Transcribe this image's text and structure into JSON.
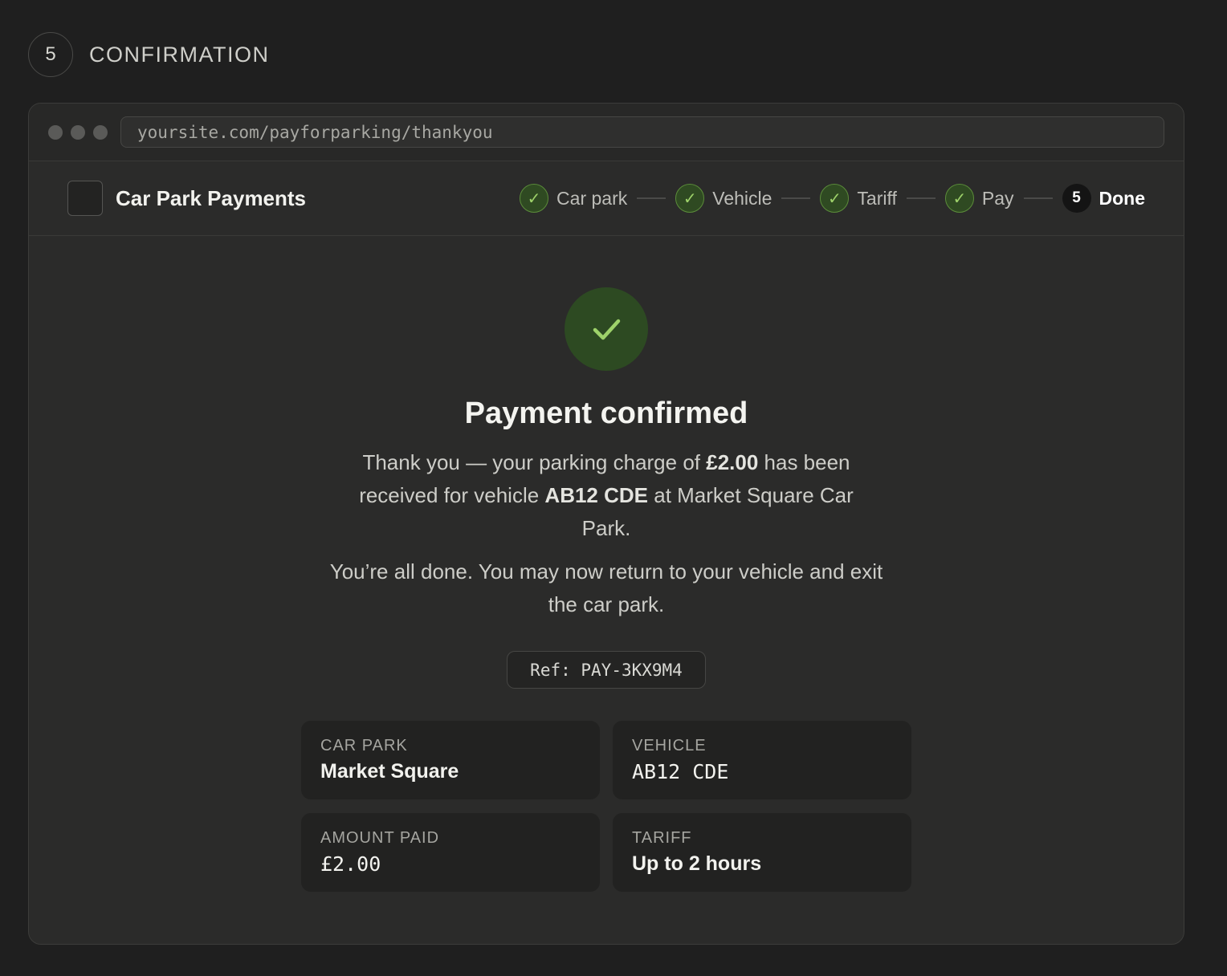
{
  "step": {
    "number": "5",
    "title": "CONFIRMATION"
  },
  "browser": {
    "url": "yoursite.com/payforparking/thankyou"
  },
  "app": {
    "name": "Car Park Payments"
  },
  "progress": [
    {
      "label": "Car park",
      "state": "done",
      "icon": "check-icon"
    },
    {
      "label": "Vehicle",
      "state": "done",
      "icon": "check-icon"
    },
    {
      "label": "Tariff",
      "state": "done",
      "icon": "check-icon"
    },
    {
      "label": "Pay",
      "state": "done",
      "icon": "check-icon"
    },
    {
      "label": "Done",
      "state": "current",
      "number": "5"
    }
  ],
  "confirmation": {
    "icon": "check-icon",
    "headline": "Payment confirmed",
    "message": {
      "prefix": "Thank you — your parking charge of ",
      "amount": "£2.00",
      "middle": " has been received for vehicle ",
      "vehicle": "AB12 CDE",
      "suffix": " at Market Square Car Park."
    },
    "followup": "You’re all done. You may now return to your vehicle and exit the car park.",
    "reference": "Ref: PAY-3KX9M4"
  },
  "summary": {
    "car_park": {
      "label": "CAR PARK",
      "value": "Market Square"
    },
    "vehicle": {
      "label": "VEHICLE",
      "value": "AB12 CDE"
    },
    "amount_paid": {
      "label": "AMOUNT PAID",
      "value": "£2.00"
    },
    "tariff": {
      "label": "TARIFF",
      "value": "Up to 2 hours"
    }
  },
  "colors": {
    "success_green": "#9ed26a",
    "success_bg": "#2d4a22",
    "background": "#1f1f1f",
    "panel": "#2b2b2a"
  }
}
